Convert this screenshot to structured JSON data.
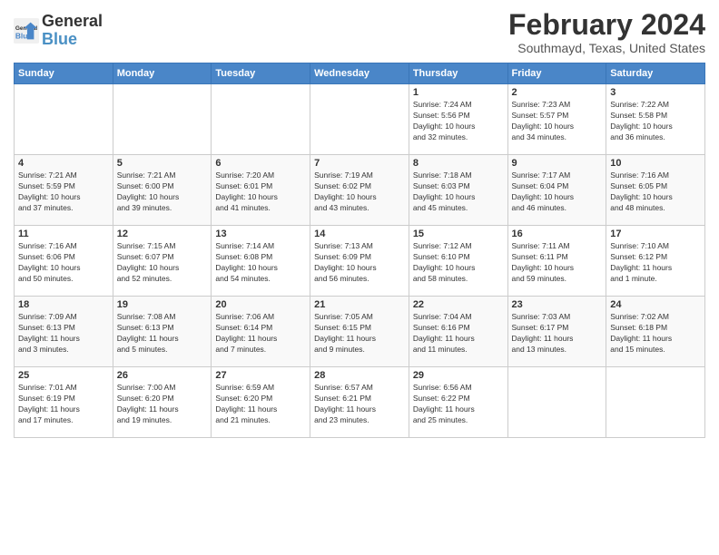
{
  "logo": {
    "line1": "General",
    "line2": "Blue"
  },
  "header": {
    "month_title": "February 2024",
    "location": "Southmayd, Texas, United States"
  },
  "days_of_week": [
    "Sunday",
    "Monday",
    "Tuesday",
    "Wednesday",
    "Thursday",
    "Friday",
    "Saturday"
  ],
  "weeks": [
    [
      {
        "day": "",
        "info": ""
      },
      {
        "day": "",
        "info": ""
      },
      {
        "day": "",
        "info": ""
      },
      {
        "day": "",
        "info": ""
      },
      {
        "day": "1",
        "info": "Sunrise: 7:24 AM\nSunset: 5:56 PM\nDaylight: 10 hours\nand 32 minutes."
      },
      {
        "day": "2",
        "info": "Sunrise: 7:23 AM\nSunset: 5:57 PM\nDaylight: 10 hours\nand 34 minutes."
      },
      {
        "day": "3",
        "info": "Sunrise: 7:22 AM\nSunset: 5:58 PM\nDaylight: 10 hours\nand 36 minutes."
      }
    ],
    [
      {
        "day": "4",
        "info": "Sunrise: 7:21 AM\nSunset: 5:59 PM\nDaylight: 10 hours\nand 37 minutes."
      },
      {
        "day": "5",
        "info": "Sunrise: 7:21 AM\nSunset: 6:00 PM\nDaylight: 10 hours\nand 39 minutes."
      },
      {
        "day": "6",
        "info": "Sunrise: 7:20 AM\nSunset: 6:01 PM\nDaylight: 10 hours\nand 41 minutes."
      },
      {
        "day": "7",
        "info": "Sunrise: 7:19 AM\nSunset: 6:02 PM\nDaylight: 10 hours\nand 43 minutes."
      },
      {
        "day": "8",
        "info": "Sunrise: 7:18 AM\nSunset: 6:03 PM\nDaylight: 10 hours\nand 45 minutes."
      },
      {
        "day": "9",
        "info": "Sunrise: 7:17 AM\nSunset: 6:04 PM\nDaylight: 10 hours\nand 46 minutes."
      },
      {
        "day": "10",
        "info": "Sunrise: 7:16 AM\nSunset: 6:05 PM\nDaylight: 10 hours\nand 48 minutes."
      }
    ],
    [
      {
        "day": "11",
        "info": "Sunrise: 7:16 AM\nSunset: 6:06 PM\nDaylight: 10 hours\nand 50 minutes."
      },
      {
        "day": "12",
        "info": "Sunrise: 7:15 AM\nSunset: 6:07 PM\nDaylight: 10 hours\nand 52 minutes."
      },
      {
        "day": "13",
        "info": "Sunrise: 7:14 AM\nSunset: 6:08 PM\nDaylight: 10 hours\nand 54 minutes."
      },
      {
        "day": "14",
        "info": "Sunrise: 7:13 AM\nSunset: 6:09 PM\nDaylight: 10 hours\nand 56 minutes."
      },
      {
        "day": "15",
        "info": "Sunrise: 7:12 AM\nSunset: 6:10 PM\nDaylight: 10 hours\nand 58 minutes."
      },
      {
        "day": "16",
        "info": "Sunrise: 7:11 AM\nSunset: 6:11 PM\nDaylight: 10 hours\nand 59 minutes."
      },
      {
        "day": "17",
        "info": "Sunrise: 7:10 AM\nSunset: 6:12 PM\nDaylight: 11 hours\nand 1 minute."
      }
    ],
    [
      {
        "day": "18",
        "info": "Sunrise: 7:09 AM\nSunset: 6:13 PM\nDaylight: 11 hours\nand 3 minutes."
      },
      {
        "day": "19",
        "info": "Sunrise: 7:08 AM\nSunset: 6:13 PM\nDaylight: 11 hours\nand 5 minutes."
      },
      {
        "day": "20",
        "info": "Sunrise: 7:06 AM\nSunset: 6:14 PM\nDaylight: 11 hours\nand 7 minutes."
      },
      {
        "day": "21",
        "info": "Sunrise: 7:05 AM\nSunset: 6:15 PM\nDaylight: 11 hours\nand 9 minutes."
      },
      {
        "day": "22",
        "info": "Sunrise: 7:04 AM\nSunset: 6:16 PM\nDaylight: 11 hours\nand 11 minutes."
      },
      {
        "day": "23",
        "info": "Sunrise: 7:03 AM\nSunset: 6:17 PM\nDaylight: 11 hours\nand 13 minutes."
      },
      {
        "day": "24",
        "info": "Sunrise: 7:02 AM\nSunset: 6:18 PM\nDaylight: 11 hours\nand 15 minutes."
      }
    ],
    [
      {
        "day": "25",
        "info": "Sunrise: 7:01 AM\nSunset: 6:19 PM\nDaylight: 11 hours\nand 17 minutes."
      },
      {
        "day": "26",
        "info": "Sunrise: 7:00 AM\nSunset: 6:20 PM\nDaylight: 11 hours\nand 19 minutes."
      },
      {
        "day": "27",
        "info": "Sunrise: 6:59 AM\nSunset: 6:20 PM\nDaylight: 11 hours\nand 21 minutes."
      },
      {
        "day": "28",
        "info": "Sunrise: 6:57 AM\nSunset: 6:21 PM\nDaylight: 11 hours\nand 23 minutes."
      },
      {
        "day": "29",
        "info": "Sunrise: 6:56 AM\nSunset: 6:22 PM\nDaylight: 11 hours\nand 25 minutes."
      },
      {
        "day": "",
        "info": ""
      },
      {
        "day": "",
        "info": ""
      }
    ]
  ]
}
